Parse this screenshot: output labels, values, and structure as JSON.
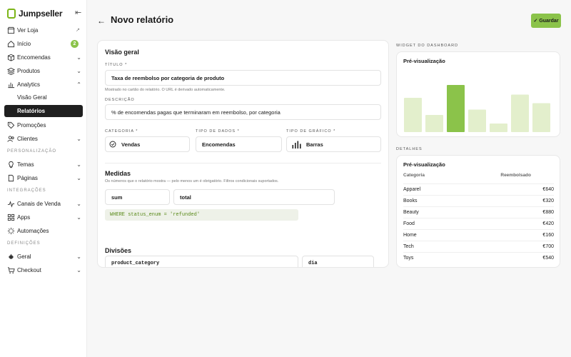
{
  "brand": {
    "name": "Jumpseller"
  },
  "sidebar": {
    "items": [
      {
        "label": "Ver Loja",
        "icon": "store-icon"
      },
      {
        "label": "Início",
        "icon": "home-icon",
        "badge": "2"
      },
      {
        "label": "Encomendas",
        "icon": "box-icon"
      },
      {
        "label": "Produtos",
        "icon": "layers-icon"
      },
      {
        "label": "Analytics",
        "icon": "chart-icon"
      }
    ],
    "analytics_sub": [
      {
        "label": "Visão Geral"
      },
      {
        "label": "Relatórios"
      }
    ],
    "items2": [
      {
        "label": "Promoções",
        "icon": "tag-icon"
      },
      {
        "label": "Clientes",
        "icon": "users-icon"
      }
    ],
    "section_personalizacao": "PERSONALIZAÇÃO",
    "items3": [
      {
        "label": "Temas",
        "icon": "bulb-icon"
      },
      {
        "label": "Páginas",
        "icon": "page-icon"
      }
    ],
    "section_integracoes": "INTEGRAÇÕES",
    "items4": [
      {
        "label": "Canais de Venda",
        "icon": "pulse-icon"
      },
      {
        "label": "Apps",
        "icon": "grid-icon"
      },
      {
        "label": "Automações",
        "icon": "sparkle-icon"
      }
    ],
    "section_definicoes": "DEFINIÇÕES",
    "items5": [
      {
        "label": "Geral",
        "icon": "gear-icon"
      },
      {
        "label": "Checkout",
        "icon": "cart-icon"
      }
    ]
  },
  "header": {
    "title": "Novo relatório",
    "save_label": "Guardar"
  },
  "form": {
    "overview_title": "Visão geral",
    "title_label": "TÍTULO *",
    "title_value": "Taxa de reembolso por categoria de produto",
    "title_hint": "Mostrado no cartão do relatório. O URL é derivado automaticamente.",
    "description_label": "DESCRIÇÃO",
    "description_value": "% de encomendas pagas que terminaram em reembolso, por categoria",
    "category_label": "CATEGORIA *",
    "category_value": "Vendas",
    "data_type_label": "TIPO DE DADOS *",
    "data_type_value": "Encomendas",
    "chart_type_label": "TIPO DE GRÁFICO *",
    "chart_type_value": "Barras",
    "measures_title": "Medidas",
    "measures_hint": "Os números que o relatório mostra — pelo menos um é obrigatório. Filtros condicionais suportados.",
    "measure_func": "sum",
    "measure_field": "total",
    "measure_filter": "WHERE status_enum = 'refunded'",
    "divisions_title": "Divisões",
    "division_field": "product_category",
    "division_period": "dia"
  },
  "widget": {
    "section_label": "WIDGET DO DASHBOARD",
    "preview_title": "Pré-visualização",
    "bars": [
      {
        "value": 640,
        "highlight": false
      },
      {
        "value": 320,
        "highlight": false
      },
      {
        "value": 880,
        "highlight": true
      },
      {
        "value": 420,
        "highlight": false
      },
      {
        "value": 160,
        "highlight": false
      },
      {
        "value": 700,
        "highlight": false
      },
      {
        "value": 540,
        "highlight": false
      }
    ],
    "colors": {
      "bar": "#e3efcc",
      "bar_highlight": "#8bc34a"
    }
  },
  "details": {
    "section_label": "DETALHES",
    "preview_title": "Pré-visualização",
    "col_category": "Categoria",
    "col_refund": "Reembolsado",
    "rows": [
      {
        "category": "Apparel",
        "value": "€640"
      },
      {
        "category": "Books",
        "value": "€320"
      },
      {
        "category": "Beauty",
        "value": "€880"
      },
      {
        "category": "Food",
        "value": "€420"
      },
      {
        "category": "Home",
        "value": "€160"
      },
      {
        "category": "Tech",
        "value": "€700"
      },
      {
        "category": "Toys",
        "value": "€540"
      }
    ]
  },
  "theme": {
    "accent": "#8bc34a",
    "dark": "#1f1f1f"
  }
}
